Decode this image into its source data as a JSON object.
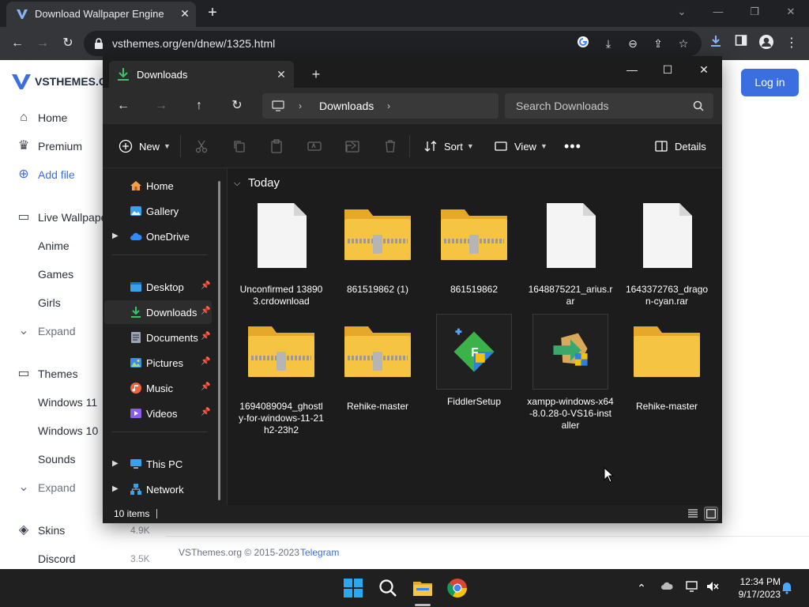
{
  "browser": {
    "tab_title": "Download Wallpaper Engine",
    "url": "vsthemes.org/en/dnew/1325.html"
  },
  "site": {
    "logo": "VSTHEMES.ORG",
    "login_label": "Log in",
    "nav": [
      {
        "label": "Home",
        "icon": "home-icon"
      },
      {
        "label": "Premium",
        "icon": "crown-icon"
      },
      {
        "label": "Add file",
        "icon": "plus-circle-icon"
      },
      {
        "label": "Live Wallpapers",
        "icon": "monitor-icon"
      },
      {
        "label": "Anime"
      },
      {
        "label": "Games"
      },
      {
        "label": "Girls"
      },
      {
        "label": "Expand",
        "icon": "chevron-down-icon"
      },
      {
        "label": "Themes",
        "icon": "monitor-icon"
      },
      {
        "label": "Windows 11"
      },
      {
        "label": "Windows 10"
      },
      {
        "label": "Sounds"
      },
      {
        "label": "Expand",
        "icon": "chevron-down-icon"
      },
      {
        "label": "Skins",
        "icon": "skin-icon",
        "count": "4.9K"
      },
      {
        "label": "Discord",
        "count": "3.5K"
      }
    ],
    "footer_copyright": "VSThemes.org © 2015-2023",
    "footer_link": "Telegram"
  },
  "explorer": {
    "tab_title": "Downloads",
    "breadcrumb": "Downloads",
    "search_placeholder": "Search Downloads",
    "commands": {
      "new": "New",
      "sort": "Sort",
      "view": "View",
      "details": "Details"
    },
    "sidebar": [
      {
        "label": "Home",
        "icon": "home-icon"
      },
      {
        "label": "Gallery",
        "icon": "gallery-icon"
      },
      {
        "label": "OneDrive",
        "icon": "cloud-icon",
        "expandable": true
      },
      {
        "label": "Desktop",
        "icon": "desktop-icon",
        "pinned": true
      },
      {
        "label": "Downloads",
        "icon": "download-icon",
        "pinned": true,
        "selected": true
      },
      {
        "label": "Documents",
        "icon": "documents-icon",
        "pinned": true
      },
      {
        "label": "Pictures",
        "icon": "pictures-icon",
        "pinned": true
      },
      {
        "label": "Music",
        "icon": "music-icon",
        "pinned": true
      },
      {
        "label": "Videos",
        "icon": "videos-icon",
        "pinned": true
      },
      {
        "label": "This PC",
        "icon": "pc-icon",
        "expandable": true
      },
      {
        "label": "Network",
        "icon": "network-icon",
        "expandable": true
      }
    ],
    "group_label": "Today",
    "files": [
      {
        "name": "Unconfirmed 138903.crdownload",
        "type": "file"
      },
      {
        "name": "861519862 (1)",
        "type": "zip"
      },
      {
        "name": "861519862",
        "type": "zip"
      },
      {
        "name": "1648875221_arius.rar",
        "type": "file"
      },
      {
        "name": "1643372763_dragon-cyan.rar",
        "type": "file"
      },
      {
        "name": "1694089094_ghostly-for-windows-11-21h2-23h2",
        "type": "zip"
      },
      {
        "name": "Rehike-master",
        "type": "zip"
      },
      {
        "name": "FiddlerSetup",
        "type": "fiddler"
      },
      {
        "name": "xampp-windows-x64-8.0.28-0-VS16-installer",
        "type": "xampp"
      },
      {
        "name": "Rehike-master",
        "type": "folder"
      }
    ],
    "status": "10 items"
  },
  "taskbar": {
    "time": "12:34 PM",
    "date": "9/17/2023"
  },
  "colors": {
    "accent": "#3b6fe0",
    "folder": "#f6c443",
    "explorer_bg": "#202020",
    "download_green": "#3cc26a"
  }
}
